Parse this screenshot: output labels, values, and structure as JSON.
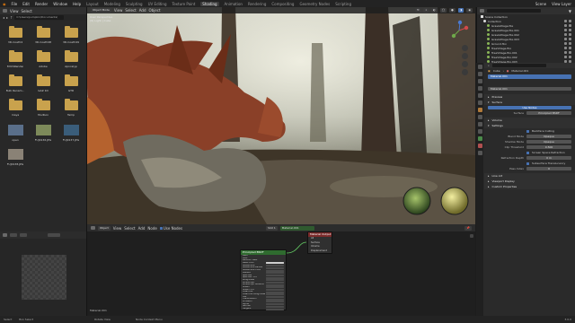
{
  "topbar": {
    "menus": [
      "File",
      "Edit",
      "Render",
      "Window",
      "Help"
    ],
    "workspaces": [
      "Layout",
      "Modeling",
      "Sculpting",
      "UV Editing",
      "Texture Paint",
      "Shading",
      "Animation",
      "Rendering",
      "Compositing",
      "Geometry Nodes",
      "Scripting"
    ],
    "active_workspace": "Shading",
    "scene": "Scene",
    "view_layer": "View Layer"
  },
  "filebrowser": {
    "menus": [
      "View",
      "Select"
    ],
    "path": "C:\\Users\\pumpkin\\Documents\\",
    "items": [
      {
        "name": "3D-CoatV4",
        "kind": "folder"
      },
      {
        "name": "3D-CoatV48",
        "kind": "folder"
      },
      {
        "name": "3D-CoatV49",
        "kind": "folder"
      },
      {
        "name": "3DCSRender",
        "kind": "folder"
      },
      {
        "name": "Adobe",
        "kind": "folder"
      },
      {
        "name": "Apocalyp",
        "kind": "folder"
      },
      {
        "name": "Bulk Renam...",
        "kind": "folder"
      },
      {
        "name": "GAZ 1D",
        "kind": "folder"
      },
      {
        "name": "GTR",
        "kind": "folder"
      },
      {
        "name": "maya",
        "kind": "folder"
      },
      {
        "name": "Mudbox",
        "kind": "folder"
      },
      {
        "name": "Temp",
        "kind": "folder"
      },
      {
        "name": "open",
        "kind": "image",
        "color": "#5a6f8a"
      },
      {
        "name": "FUJ0136.JPG",
        "kind": "image",
        "color": "#7d8a5a"
      },
      {
        "name": "FUJ0137.JPG",
        "kind": "image",
        "color": "#3a5d7a"
      },
      {
        "name": "FUJ0138.JPG",
        "kind": "image",
        "color": "#8a8276"
      }
    ]
  },
  "viewport": {
    "header": [
      "Object Mode",
      "View",
      "Select",
      "Add",
      "Object"
    ],
    "info_line1": "User Perspective",
    "info_line2": "(9) Light | Cube"
  },
  "node_header": {
    "items": [
      "Object",
      "View",
      "Select",
      "Add",
      "Node",
      "Use Nodes",
      "Slot 1",
      "Material.001"
    ]
  },
  "node_editor": {
    "bsdf_title": "Principled BSDF",
    "bsdf_rows": [
      "BSDF",
      "GGX",
      "Random Walk",
      "Base Color",
      "Subsurface",
      "Subsurface Radius",
      "Subsurface Color",
      "Metallic",
      "Specular",
      "Specular Tint",
      "Roughness",
      "Anisotropic",
      "Anisotropic Rotation",
      "Sheen",
      "Sheen Tint",
      "Clearcoat",
      "Clearcoat Roughness",
      "IOR",
      "Transmission",
      "Emission",
      "Alpha",
      "Normal",
      "Tangent"
    ],
    "output_title": "Material Output",
    "output_rows": [
      "All",
      "Surface",
      "Volume",
      "Displacement"
    ],
    "material_label": "Material.001"
  },
  "outliner": {
    "title": "Scene Collection",
    "rows": [
      "Collection",
      "GrassVillage.fbx",
      "GrassVillage.fbx.001",
      "GrassVillage.fbx.002",
      "GrassVillage.fbx.003",
      "Ground.fbx",
      "TreeVillage.fbx",
      "TreeVillage.fbx.001",
      "TreeVillage.fbx.002",
      "TreeVillage.fbx.003"
    ]
  },
  "properties": {
    "tabs": [
      "Cube",
      "Material.001"
    ],
    "slot": "Material.001",
    "material_name": "Material.001",
    "sections": {
      "preview": "Preview",
      "surface": "Surface",
      "use_nodes": "Use Nodes",
      "surface_label": "Surface",
      "surface_value": "Principled BSDF",
      "volume": "Volume",
      "settings": "Settings",
      "line_art": "Line Art",
      "viewport_display": "Viewport Display",
      "custom_properties": "Custom Properties"
    },
    "settings_rows": [
      {
        "label": "",
        "value": "Backface Culling",
        "type": "check"
      },
      {
        "label": "Blend Mode",
        "value": "Opaque",
        "type": "field"
      },
      {
        "label": "Shadow Mode",
        "value": "Opaque",
        "type": "field"
      },
      {
        "label": "Clip Threshold",
        "value": "0.500",
        "type": "field"
      },
      {
        "label": "",
        "value": "Screen Space Refraction",
        "type": "check"
      },
      {
        "label": "Refraction Depth",
        "value": "0 m",
        "type": "field"
      },
      {
        "label": "",
        "value": "Subsurface Translucency",
        "type": "check"
      },
      {
        "label": "Pass Index",
        "value": "0",
        "type": "field"
      }
    ]
  },
  "status": {
    "items": [
      "Select",
      "Box Select",
      "Rotate View",
      "Node Context Menu"
    ],
    "version": "3.0.0"
  }
}
